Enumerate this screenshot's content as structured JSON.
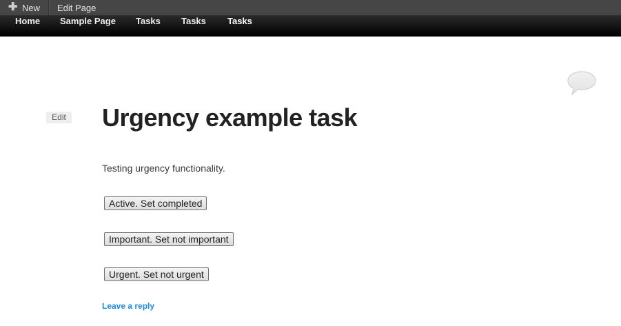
{
  "adminbar": {
    "new_label": "New",
    "edit_page_label": "Edit Page"
  },
  "nav": {
    "items": [
      {
        "label": "Home"
      },
      {
        "label": "Sample Page"
      },
      {
        "label": "Tasks"
      },
      {
        "label": "Tasks"
      },
      {
        "label": "Tasks"
      }
    ]
  },
  "post": {
    "edit_label": "Edit",
    "title": "Urgency example task",
    "body": "Testing urgency functionality.",
    "buttons": {
      "active": "Active. Set completed",
      "important": "Important. Set not important",
      "urgent": "Urgent. Set not urgent"
    },
    "reply_link": "Leave a reply"
  },
  "colors": {
    "adminbar_bg": "#464646",
    "nav_bg": "#000000",
    "link": "#1b8be0"
  },
  "icons": [
    "plus-icon",
    "comment-bubble-icon"
  ]
}
